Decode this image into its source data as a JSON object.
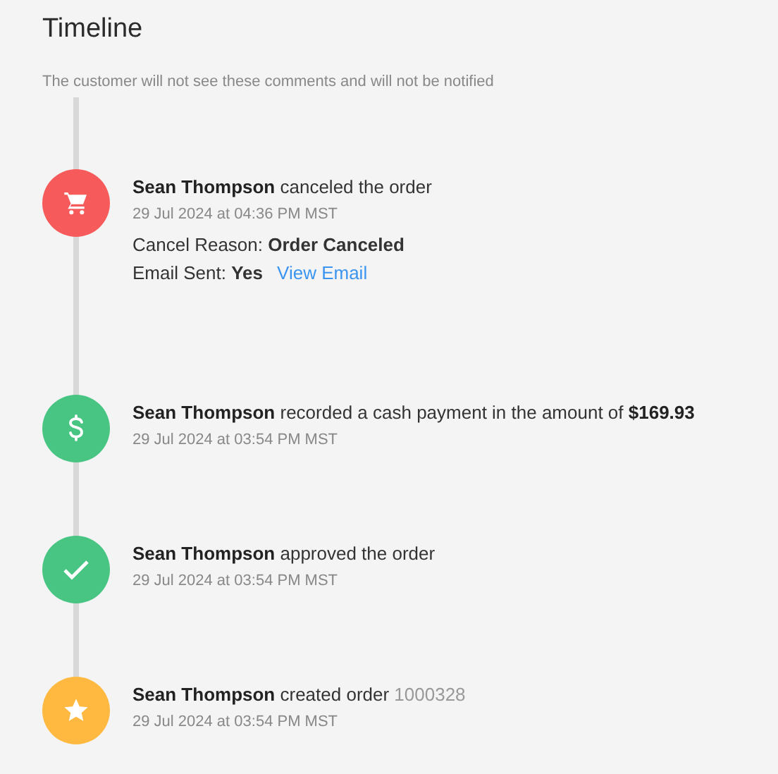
{
  "title": "Timeline",
  "note": "The customer will not see these comments and will not be notified",
  "events": [
    {
      "kind": "cart",
      "color": "#f75a5a",
      "headline": "**Sean Thompson** canceled the order",
      "timestamp": "29 Jul 2024 at 04:36 PM MST",
      "details": [
        "Cancel Reason: **Order Canceled**",
        "Email Sent: **Yes**"
      ],
      "link": "View Email"
    },
    {
      "kind": "dollar",
      "color": "#48c583",
      "headline": "**Sean Thompson** recorded a cash payment in the amount of **$169.93**",
      "timestamp": "29 Jul 2024 at 03:54 PM MST"
    },
    {
      "kind": "check",
      "color": "#48c583",
      "headline": "**Sean Thompson** approved the order",
      "timestamp": "29 Jul 2024 at 03:54 PM MST"
    },
    {
      "kind": "star",
      "color": "#ffb940",
      "headline": "**Sean Thompson** created order",
      "reference": "1000328",
      "timestamp": "29 Jul 2024 at 03:54 PM MST"
    }
  ]
}
